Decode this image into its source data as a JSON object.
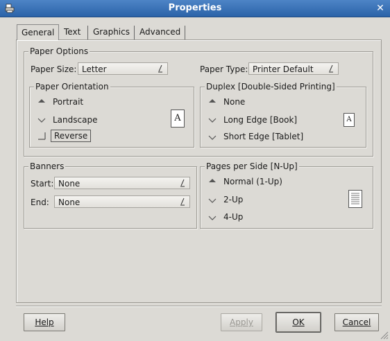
{
  "window": {
    "title": "Properties"
  },
  "tabs": [
    {
      "label": "General",
      "active": true
    },
    {
      "label": "Text",
      "active": false
    },
    {
      "label": "Graphics",
      "active": false
    },
    {
      "label": "Advanced",
      "active": false
    }
  ],
  "paper_options": {
    "legend": "Paper Options",
    "paper_size_label": "Paper Size:",
    "paper_size_value": "Letter",
    "paper_type_label": "Paper Type:",
    "paper_type_value": "Printer Default"
  },
  "orientation": {
    "legend": "Paper Orientation",
    "options": [
      "Portrait",
      "Landscape"
    ],
    "selected": "Portrait",
    "reverse_label": "Reverse",
    "preview_glyph": "A"
  },
  "duplex": {
    "legend": "Duplex [Double-Sided Printing]",
    "options": [
      "None",
      "Long Edge [Book]",
      "Short Edge [Tablet]"
    ],
    "selected": "None",
    "preview_glyph": "A"
  },
  "banners": {
    "legend": "Banners",
    "start_label": "Start:",
    "start_value": "None",
    "end_label": "End:",
    "end_value": "None"
  },
  "nup": {
    "legend": "Pages per Side [N-Up]",
    "options": [
      "Normal (1-Up)",
      "2-Up",
      "4-Up"
    ],
    "selected": "Normal (1-Up)"
  },
  "buttons": {
    "help": "Help",
    "apply": "Apply",
    "ok": "OK",
    "cancel": "Cancel"
  }
}
